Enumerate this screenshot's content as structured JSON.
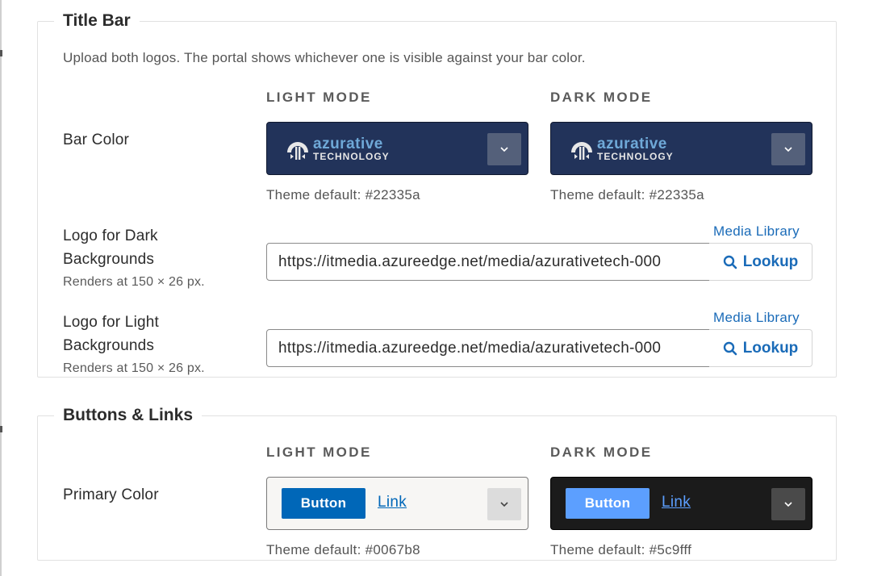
{
  "title_bar": {
    "legend": "Title Bar",
    "description": "Upload both logos. The portal shows whichever one is visible against your bar color.",
    "light_mode_heading": "LIGHT MODE",
    "dark_mode_heading": "DARK MODE",
    "bar_color": {
      "label": "Bar Color",
      "light": {
        "swatch_color": "#22335a",
        "logo_top": "azurative",
        "logo_bottom": "TECHNOLOGY",
        "theme_default": "Theme default: #22335a"
      },
      "dark": {
        "swatch_color": "#22335a",
        "logo_top": "azurative",
        "logo_bottom": "TECHNOLOGY",
        "theme_default": "Theme default: #22335a"
      }
    },
    "logo_dark": {
      "label_line1": "Logo for Dark",
      "label_line2": "Backgrounds",
      "hint": "Renders at 150 × 26 px.",
      "media_library": "Media Library",
      "url_value": "https://itmedia.azureedge.net/media/azurativetech-000",
      "lookup_label": "Lookup"
    },
    "logo_light": {
      "label_line1": "Logo for Light",
      "label_line2": "Backgrounds",
      "hint": "Renders at 150 × 26 px.",
      "media_library": "Media Library",
      "url_value": "https://itmedia.azureedge.net/media/azurativetech-000",
      "lookup_label": "Lookup"
    }
  },
  "buttons_links": {
    "legend": "Buttons & Links",
    "light_mode_heading": "LIGHT MODE",
    "dark_mode_heading": "DARK MODE",
    "primary_color": {
      "label": "Primary Color",
      "light": {
        "button_label": "Button",
        "link_label": "Link",
        "button_color": "#0067b8",
        "theme_default": "Theme default: #0067b8"
      },
      "dark": {
        "button_label": "Button",
        "link_label": "Link",
        "button_color": "#5c9fff",
        "theme_default": "Theme default: #5c9fff"
      }
    }
  },
  "colors": {
    "accent_link": "#1a6bb8",
    "bar_navy": "#22335a"
  },
  "icons": {
    "dropdown": "chevron-down-icon",
    "lookup": "search-icon",
    "logo": "azurative-logo-icon"
  }
}
